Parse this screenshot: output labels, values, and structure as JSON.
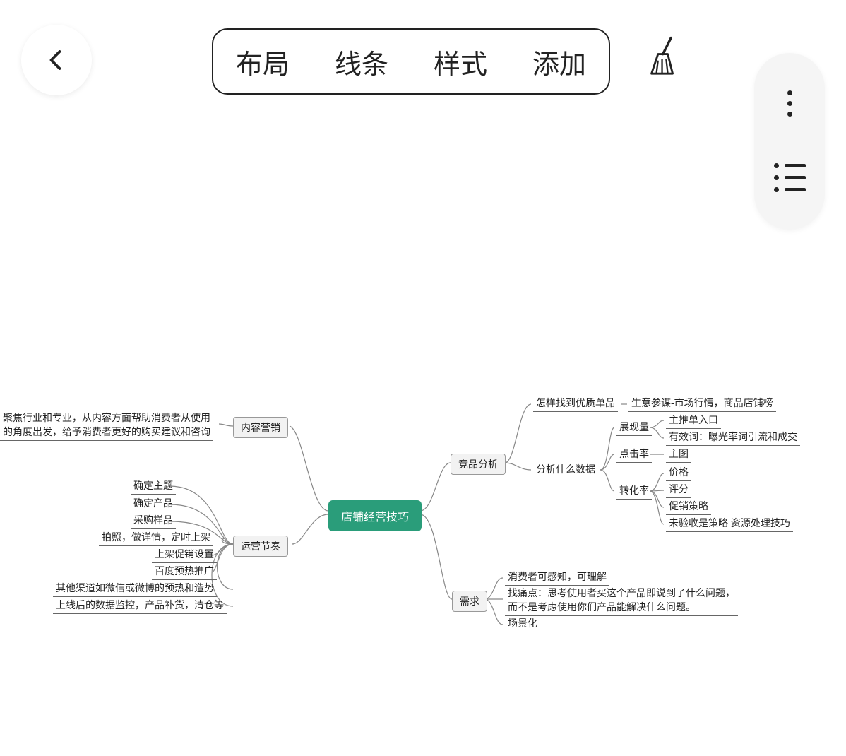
{
  "toolbar": {
    "menu": [
      "布局",
      "线条",
      "样式",
      "添加"
    ]
  },
  "root": "店铺经营技巧",
  "left": {
    "b1": "内容营销",
    "b1_leaf": "聚焦行业和专业，从内容方面帮助消费者从使用\n的角度出发，给予消费者更好的购买建议和咨询",
    "b2": "运营节奏",
    "b2_leaves": [
      "确定主题",
      "确定产品",
      "采购样品",
      "拍照，做详情，定时上架",
      "上架促销设置",
      "百度预热推广",
      "其他渠道如微信或微博的预热和造势",
      "上线后的数据监控，产品补货，清仓等"
    ]
  },
  "right": {
    "b1": "竞品分析",
    "b1_a": "怎样找到优质单品",
    "b1_a_leaf": "生意参谋-市场行情，商品店铺榜",
    "b1_b": "分析什么数据",
    "b1_b_1": "展现量",
    "b1_b_1_leaves": [
      "主推单入口",
      "有效词：曝光率词引流和成交"
    ],
    "b1_b_2": "点击率",
    "b1_b_2_leaf": "主图",
    "b1_b_3": "转化率",
    "b1_b_3_leaves": [
      "价格",
      "评分",
      "促销策略",
      "未验收是策略 资源处理技巧"
    ],
    "b2": "需求",
    "b2_leaves": [
      "消费者可感知，可理解",
      "找痛点：思考使用者买这个产品即说到了什么问题，\n而不是考虑使用你们产品能解决什么问题。",
      "场景化"
    ]
  }
}
